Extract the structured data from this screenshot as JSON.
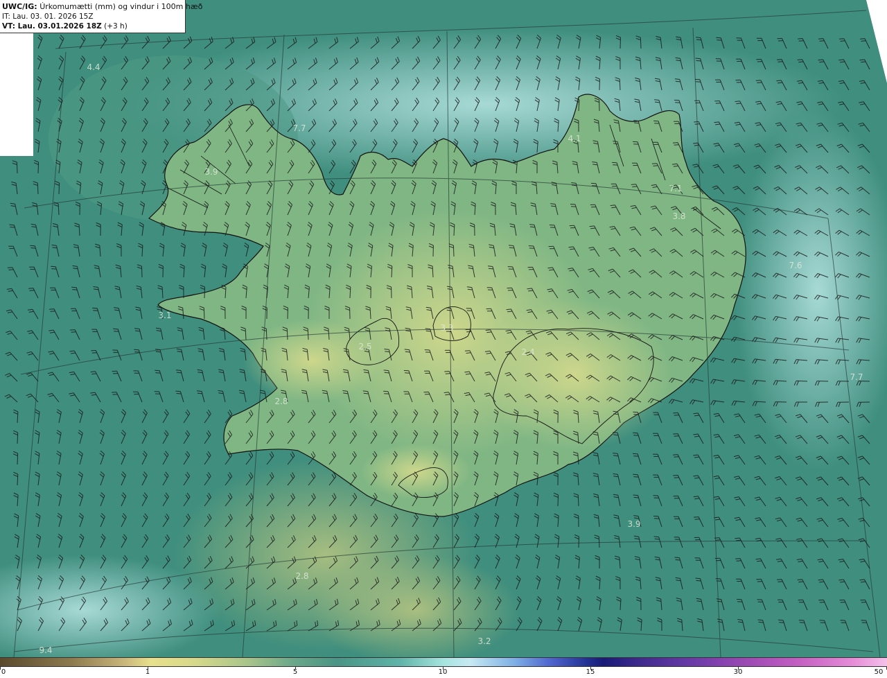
{
  "header": {
    "model": "UWC/IG:",
    "title": "Úrkomumætti (mm) og vindur i 100m hæð",
    "it_prefix": "IT:",
    "it_value": "Lau. 03. 01. 2026 15Z",
    "vt_prefix": "VT: Lau. 03.01.2026 18Z",
    "vt_suffix": "(+3 h)"
  },
  "labels": [
    "4.4",
    "7.7",
    "3.9",
    "4.1",
    "7.1",
    "3.8",
    "7.6",
    "3.1",
    "3.3",
    "2.5",
    "2.4",
    "7.7",
    "2.8",
    "3.9",
    "2.8",
    "3.2",
    "9.4"
  ],
  "colorbar": {
    "ticks": [
      "0",
      "1",
      "5",
      "10",
      "15",
      "30",
      "50"
    ]
  },
  "colors": {
    "sea": "#3f8e7e",
    "land": "#8fbf86",
    "highland": "#c5d58a",
    "coastline": "#111111"
  }
}
